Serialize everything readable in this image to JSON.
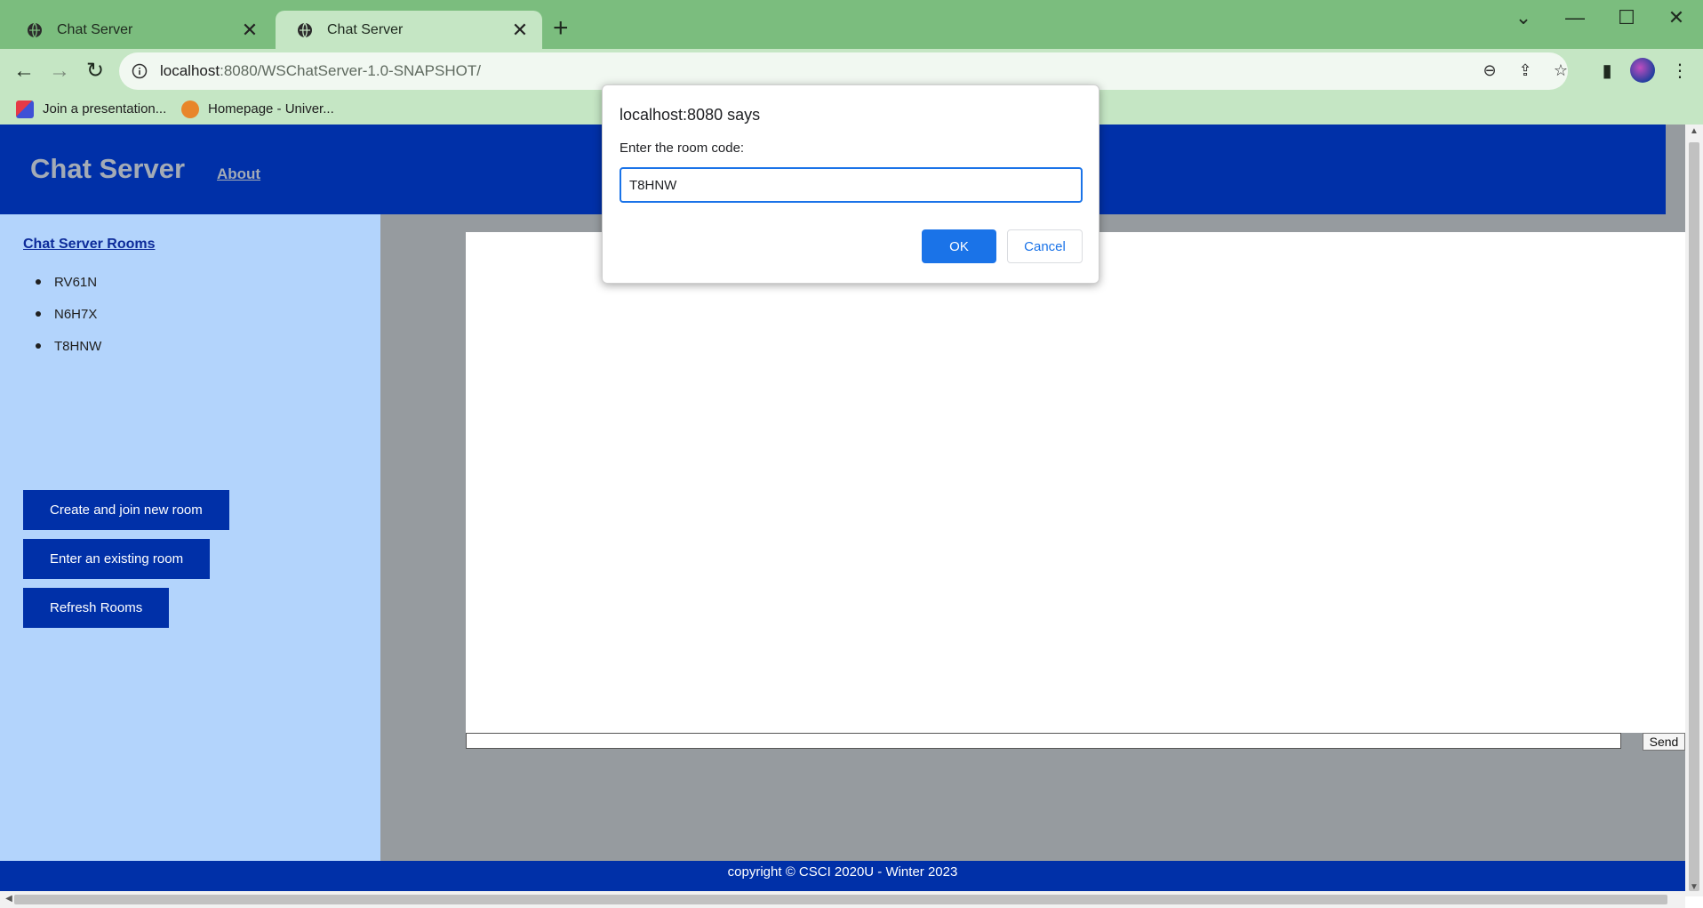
{
  "browser": {
    "tabs": [
      {
        "title": "Chat Server",
        "active": false
      },
      {
        "title": "Chat Server",
        "active": true
      }
    ],
    "url_host": "localhost",
    "url_rest": ":8080/WSChatServer-1.0-SNAPSHOT/",
    "bookmarks": [
      {
        "label": "Join a presentation..."
      },
      {
        "label": "Homepage - Univer..."
      }
    ]
  },
  "site": {
    "logo": "Chat Server",
    "nav_about": "About",
    "rooms_title": "Chat Server Rooms",
    "rooms": [
      "RV61N",
      "N6H7X",
      "T8HNW"
    ],
    "buttons": {
      "create": "Create and join new room",
      "enter": "Enter an existing room",
      "refresh": "Refresh Rooms"
    },
    "send_label": "Send",
    "footer": "copyright © CSCI 2020U - Winter 2023"
  },
  "dialog": {
    "title": "localhost:8080 says",
    "prompt": "Enter the room code:",
    "input_value": "T8HNW",
    "ok_label": "OK",
    "cancel_label": "Cancel"
  },
  "colors": {
    "tabstrip": "#7bbd7e",
    "toolbar": "#c5e6c4",
    "site_blue": "#0030a8",
    "sidebar": "#b3d4fc",
    "page_gray": "#969b9f",
    "dialog_accent": "#1a73e8"
  }
}
